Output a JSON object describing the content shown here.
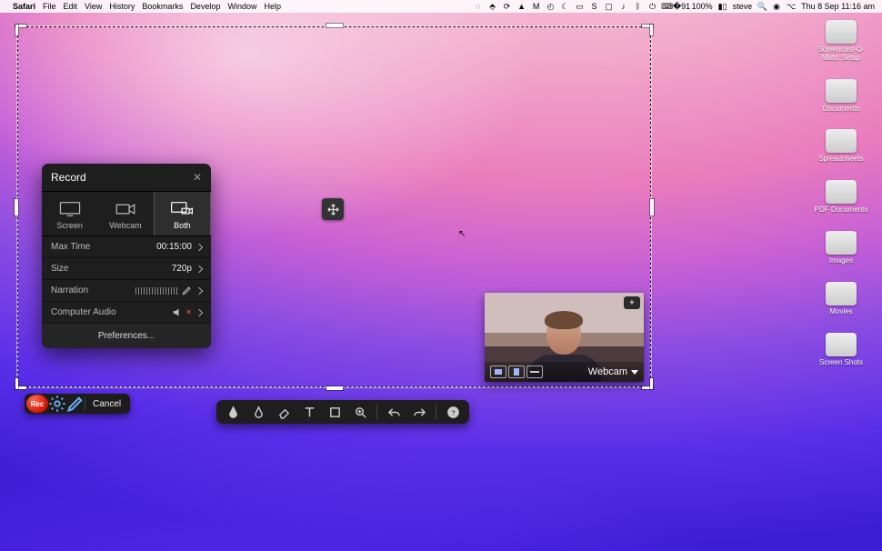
{
  "menubar": {
    "app": "Safari",
    "items": [
      "File",
      "Edit",
      "View",
      "History",
      "Bookmarks",
      "Develop",
      "Window",
      "Help"
    ],
    "right": {
      "battery": "100%",
      "user": "steve",
      "datetime": "Thu 8 Sep  11:16 am"
    }
  },
  "desktop_icons": [
    {
      "label": "Screencast-O-Matic Setup"
    },
    {
      "label": "Documents"
    },
    {
      "label": "Spreadsheets"
    },
    {
      "label": "PDF Documents"
    },
    {
      "label": "Images"
    },
    {
      "label": "Movies"
    },
    {
      "label": "Screen Shots"
    }
  ],
  "record_panel": {
    "title": "Record",
    "modes": {
      "screen": "Screen",
      "webcam": "Webcam",
      "both": "Both",
      "selected": "both"
    },
    "settings": {
      "max_time": {
        "label": "Max Time",
        "value": "00:15:00"
      },
      "size": {
        "label": "Size",
        "value": "720p"
      },
      "narration": {
        "label": "Narration"
      },
      "audio": {
        "label": "Computer Audio"
      }
    },
    "preferences": "Preferences..."
  },
  "rec_strip": {
    "rec": "Rec",
    "cancel": "Cancel"
  },
  "webcam_tile": {
    "label": "Webcam"
  }
}
